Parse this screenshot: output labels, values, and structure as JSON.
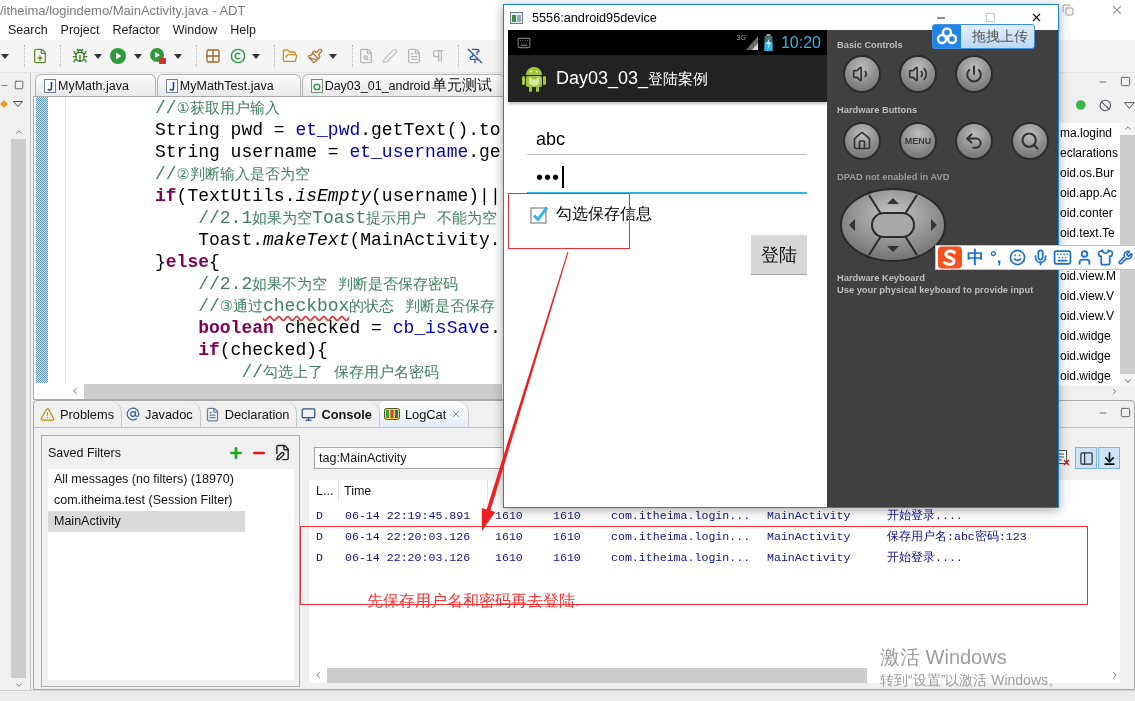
{
  "window": {
    "title": "/itheima/logindemo/MainActivity.java - ADT"
  },
  "menu": [
    "Search",
    "Project",
    "Refactor",
    "Window",
    "Help"
  ],
  "editor": {
    "tabs": [
      {
        "label": "MyMath.java",
        "kind": "java",
        "selected": false
      },
      {
        "label": "MyMathTest.java",
        "kind": "java",
        "selected": false
      },
      {
        "label": "Day03_01_android单元测试",
        "kind": "project",
        "selected": false
      }
    ],
    "lines": [
      [
        {
          "kind": "comment",
          "text": "//①获取用户输入"
        }
      ],
      [
        {
          "kind": "plain",
          "text": "String pwd = "
        },
        {
          "kind": "field",
          "text": "et_pwd"
        },
        {
          "kind": "plain",
          "text": ".getText().to"
        }
      ],
      [
        {
          "kind": "plain",
          "text": "String username = "
        },
        {
          "kind": "field",
          "text": "et_username"
        },
        {
          "kind": "plain",
          "text": ".ge"
        }
      ],
      [
        {
          "kind": "comment",
          "text": "//②判断输入是否为空"
        }
      ],
      [
        {
          "kind": "keyword",
          "text": "if"
        },
        {
          "kind": "plain",
          "text": "(TextUtils."
        },
        {
          "kind": "static",
          "text": "isEmpty"
        },
        {
          "kind": "plain",
          "text": "(username)||"
        }
      ],
      [
        {
          "kind": "comment",
          "text": "    //2.1如果为空Toast提示用户 不能为空"
        }
      ],
      [
        {
          "kind": "plain",
          "text": "    Toast."
        },
        {
          "kind": "static",
          "text": "makeText"
        },
        {
          "kind": "plain",
          "text": "(MainActivity."
        }
      ],
      [
        {
          "kind": "plain",
          "text": "}"
        },
        {
          "kind": "keyword",
          "text": "else"
        },
        {
          "kind": "plain",
          "text": "{"
        }
      ],
      [
        {
          "kind": "comment",
          "text": "    //2.2如果不为空 判断是否保存密码"
        }
      ],
      [
        {
          "kind": "comment",
          "text": "    //③通过"
        },
        {
          "kind": "misspelled",
          "text": "checkbox"
        },
        {
          "kind": "comment",
          "text": "的状态 判断是否保存"
        }
      ],
      [
        {
          "kind": "keyword",
          "text": "    boolean"
        },
        {
          "kind": "plain",
          "text": " checked = "
        },
        {
          "kind": "field",
          "text": "cb_isSave"
        },
        {
          "kind": "plain",
          "text": "."
        }
      ],
      [
        {
          "kind": "keyword",
          "text": "    if"
        },
        {
          "kind": "plain",
          "text": "(checked){"
        }
      ],
      [
        {
          "kind": "comment",
          "text": "        //勾选上了 保存用户名密码"
        }
      ]
    ]
  },
  "outline": {
    "rows_above_ime_bar": [
      "ma.logind",
      "eclarations",
      "oid.os.Bur",
      "oid.app.Ac",
      "oid.conter",
      "oid.text.Te"
    ],
    "rows_below_ime_bar": [
      "oid.view.M",
      "oid.view.V",
      "oid.view.V",
      "oid.widge",
      "oid.widge",
      "oid.widge"
    ]
  },
  "bottom_tabs": [
    {
      "label": "Problems",
      "kind": "problems",
      "selected": false,
      "updated": false
    },
    {
      "label": "Javadoc",
      "kind": "javadoc",
      "selected": false,
      "updated": false
    },
    {
      "label": "Declaration",
      "kind": "declaration",
      "selected": false,
      "updated": false
    },
    {
      "label": "Console",
      "kind": "console",
      "selected": false,
      "updated": true
    },
    {
      "label": "LogCat",
      "kind": "logcat",
      "selected": true,
      "updated": false
    }
  ],
  "saved_filters": {
    "title": "Saved Filters",
    "items": [
      {
        "label": "All messages (no filters) (18970)",
        "selected": false
      },
      {
        "label": "com.itheima.test (Session Filter)",
        "selected": false
      },
      {
        "label": "MainActivity",
        "selected": true
      }
    ]
  },
  "logcat": {
    "search_value": "tag:MainActivity",
    "toggles": [
      {
        "kind": "panel",
        "selected": true
      },
      {
        "kind": "scroll_lock",
        "selected": true
      }
    ],
    "columns": [
      "L...",
      "Time"
    ],
    "rows": [
      {
        "level": "D",
        "time": "06-14 22:19:45.891",
        "pid": "1610",
        "tid": "1610",
        "application": "com.itheima.login...",
        "tag": "MainActivity",
        "text": "开始登录...."
      },
      {
        "level": "D",
        "time": "06-14 22:20:03.126",
        "pid": "1610",
        "tid": "1610",
        "application": "com.itheima.login...",
        "tag": "MainActivity",
        "text": "保存用户名:abc密码:123"
      },
      {
        "level": "D",
        "time": "06-14 22:20:03.126",
        "pid": "1610",
        "tid": "1610",
        "application": "com.itheima.login...",
        "tag": "MainActivity",
        "text": "开始登录...."
      }
    ]
  },
  "emulator": {
    "title": "5556:android95device",
    "network": "3G",
    "time": "10:20",
    "app_title": "Day03_03_登陆案例",
    "fields": [
      {
        "value": "abc",
        "focused": false
      },
      {
        "value": "•••",
        "focused": true
      }
    ],
    "remember": {
      "label": "勾选保存信息",
      "checked": true
    },
    "login_button": "登陆",
    "panel": {
      "basic_controls": "Basic Controls",
      "hardware_buttons": "Hardware Buttons",
      "menu_key": "MENU",
      "dpad_note": "**DPAD** not enabled in AVD",
      "keyboard_title": "Hardware Keyboard",
      "keyboard_note": "Use your physical keyboard to provide input"
    }
  },
  "upload_widget": {
    "label": "拖拽上传"
  },
  "ime_bar": {
    "mode": "中",
    "punctuation": "°,"
  },
  "annotation": {
    "note": "先保存用户名和密码再去登陆."
  },
  "activation_notice": {
    "title": "激活 Windows",
    "detail": "转到“设置”以激活 Windows。"
  }
}
